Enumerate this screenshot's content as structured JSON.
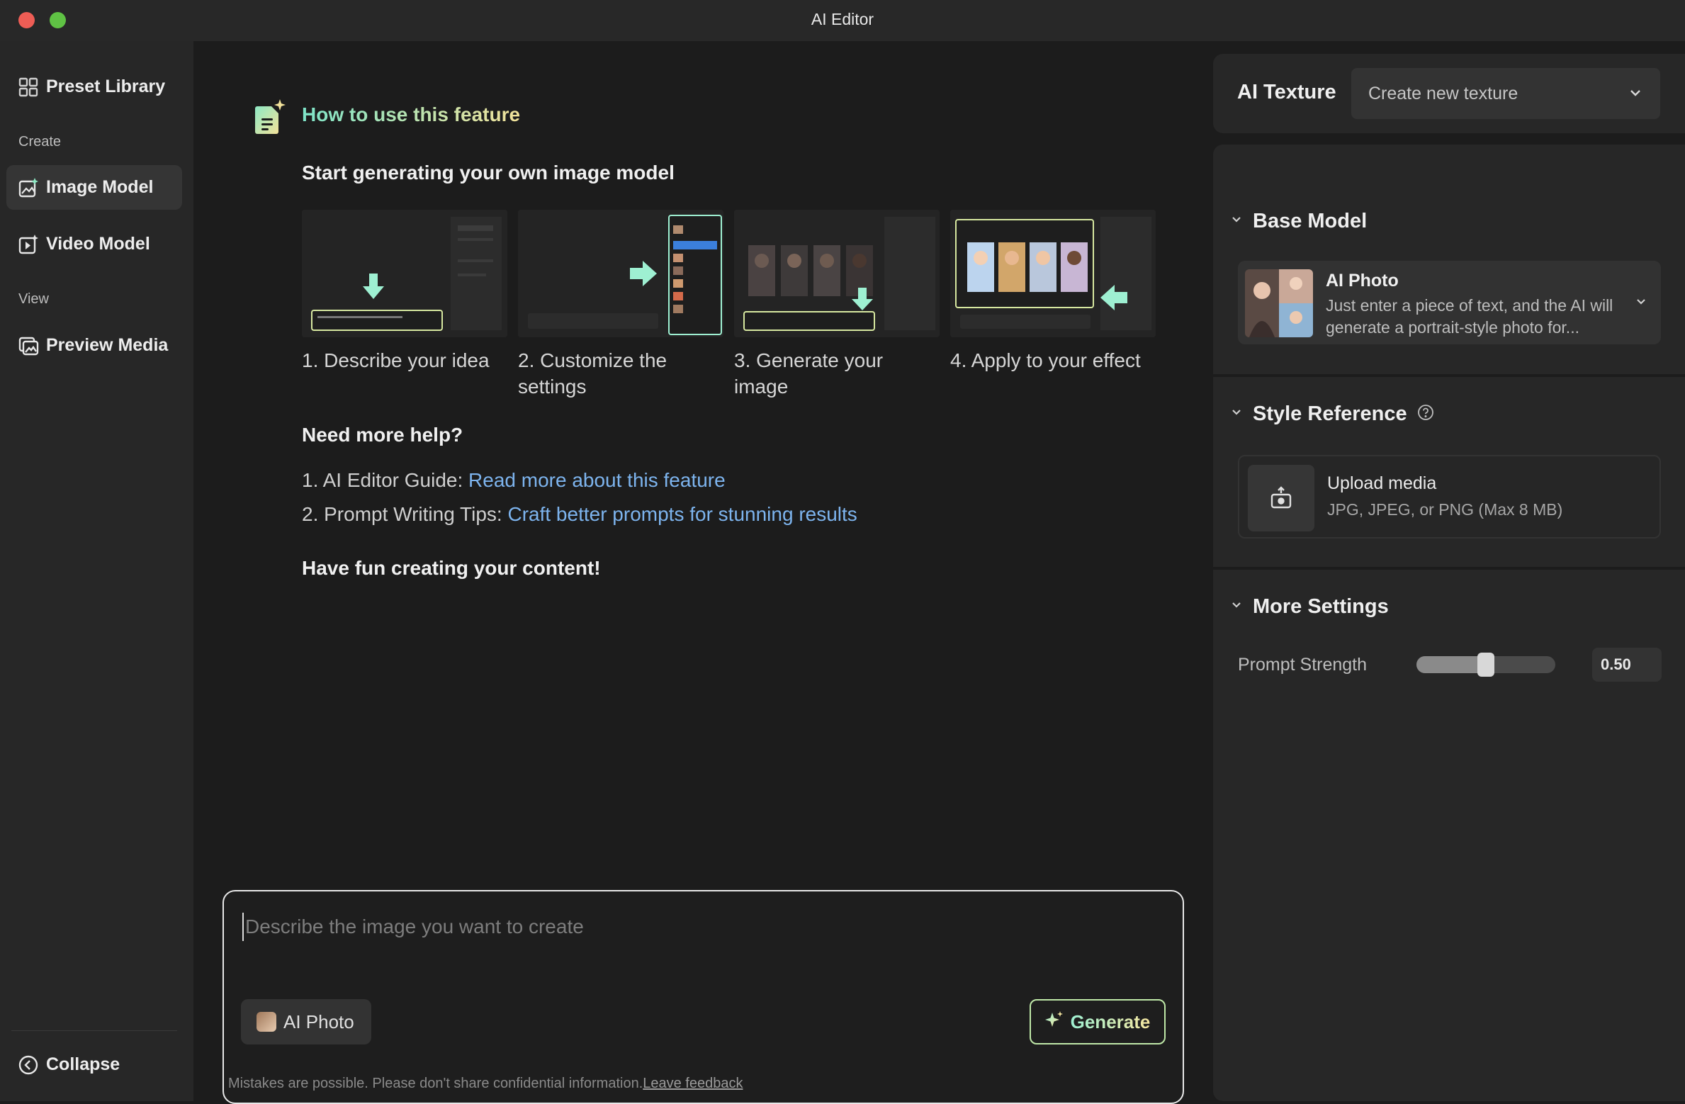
{
  "window": {
    "title": "AI Editor"
  },
  "sidebar": {
    "preset_library": "Preset Library",
    "create_section": "Create",
    "image_model": "Image Model",
    "video_model": "Video Model",
    "view_section": "View",
    "preview_media": "Preview Media",
    "collapse": "Collapse"
  },
  "main": {
    "help_title": "How to use this feature",
    "start_title": "Start generating your own image model",
    "steps": [
      {
        "caption": "1. Describe your idea"
      },
      {
        "caption": "2. Customize the settings"
      },
      {
        "caption": "3. Generate your image"
      },
      {
        "caption": "4. Apply to your effect"
      }
    ],
    "more_help_title": "Need more help?",
    "help_links": [
      {
        "prefix": "1. AI Editor Guide: ",
        "link": "Read more about this feature"
      },
      {
        "prefix": "2. Prompt Writing Tips: ",
        "link": "Craft better prompts for stunning results"
      }
    ],
    "fun_text": "Have fun creating your content!",
    "prompt": {
      "placeholder": "Describe the image you want to create",
      "value": "",
      "model_chip": "AI Photo",
      "generate_label": "Generate"
    },
    "disclaimer": "Mistakes are possible. Please don't share confidential information.",
    "feedback_link": "Leave feedback"
  },
  "right_panel": {
    "texture_label": "AI Texture",
    "texture_select": "Create new texture",
    "base_model": {
      "title": "Base Model",
      "name": "AI Photo",
      "description": "Just enter a piece of text, and the AI will generate a portrait-style photo for..."
    },
    "style_reference": {
      "title": "Style Reference",
      "upload_title": "Upload media",
      "upload_sub": "JPG, JPEG, or PNG (Max 8 MB)"
    },
    "more_settings": {
      "title": "More Settings",
      "prompt_strength_label": "Prompt Strength",
      "prompt_strength_value": "0.50",
      "prompt_strength_fraction": 0.5
    }
  },
  "colors": {
    "accent_link": "#7db4ee",
    "accent_green": "#7ee4c8",
    "accent_yellow": "#f2e29a",
    "traffic_red": "#ee5d55",
    "traffic_green": "#5fc244"
  },
  "icons": [
    "grid-icon",
    "image-sparkle-icon",
    "video-sparkle-icon",
    "preview-media-icon",
    "collapse-icon",
    "document-sparkle-icon",
    "chevron-down-icon",
    "help-circle-icon",
    "upload-icon",
    "sparkle-icon"
  ]
}
